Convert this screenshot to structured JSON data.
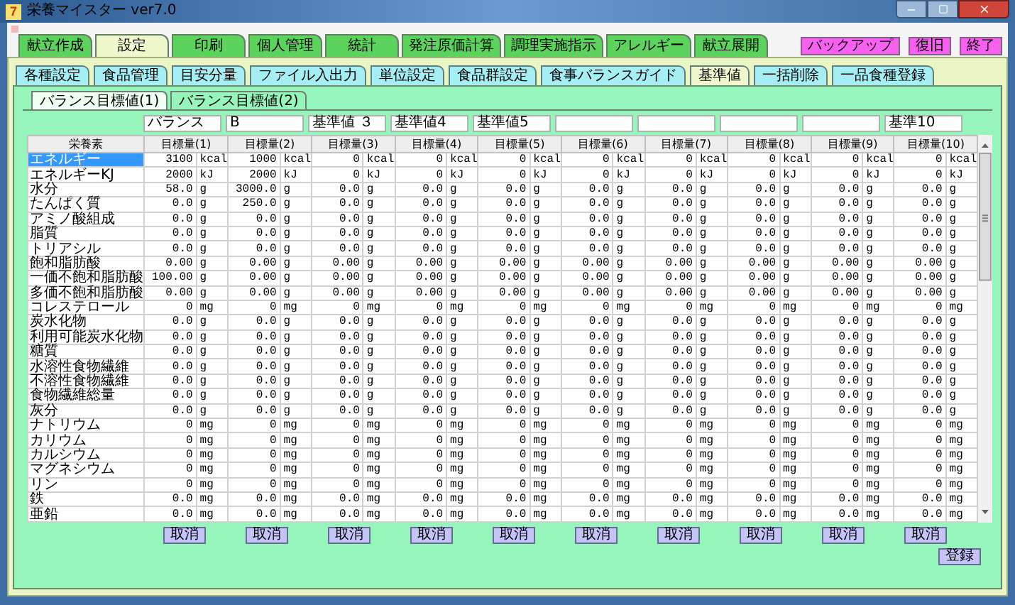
{
  "window": {
    "icon_text": "7",
    "title": "栄養マイスター ver7.0"
  },
  "main_tabs": [
    {
      "label": "献立作成",
      "selected": false
    },
    {
      "label": "設定",
      "selected": true
    },
    {
      "label": "印刷",
      "selected": false
    },
    {
      "label": "個人管理",
      "selected": false
    },
    {
      "label": "統計",
      "selected": false
    },
    {
      "label": "発注原価計算",
      "selected": false
    },
    {
      "label": "調理実施指示",
      "selected": false
    },
    {
      "label": "アレルギー",
      "selected": false
    },
    {
      "label": "献立展開",
      "selected": false
    }
  ],
  "top_buttons": [
    "バックアップ",
    "復旧",
    "終了"
  ],
  "sub_tabs": [
    {
      "label": "各種設定",
      "selected": false
    },
    {
      "label": "食品管理",
      "selected": false
    },
    {
      "label": "目安分量",
      "selected": false
    },
    {
      "label": "ファイル入出力",
      "selected": false
    },
    {
      "label": "単位設定",
      "selected": false
    },
    {
      "label": "食品群設定",
      "selected": false
    },
    {
      "label": "食事バランスガイド",
      "selected": false
    },
    {
      "label": "基準値",
      "selected": true
    },
    {
      "label": "一括削除",
      "selected": false
    },
    {
      "label": "一品食種登録",
      "selected": false
    }
  ],
  "inner_tabs": [
    {
      "label": "バランス目標値(1)",
      "selected": true
    },
    {
      "label": "バランス目標値(2)",
      "selected": false
    }
  ],
  "name_fields": [
    {
      "kind": "text",
      "value": "バランス"
    },
    {
      "kind": "text",
      "value": "B"
    },
    {
      "kind": "text",
      "value": "基準値 ３"
    },
    {
      "kind": "text",
      "value": "基準値4"
    },
    {
      "kind": "text",
      "value": "基準値5"
    },
    {
      "kind": "blank"
    },
    {
      "kind": "blank"
    },
    {
      "kind": "blank"
    },
    {
      "kind": "blank"
    },
    {
      "kind": "text",
      "value": "基準10"
    }
  ],
  "table": {
    "columns": [
      "栄養素",
      "目標量(1)",
      "目標量(2)",
      "目標量(3)",
      "目標量(4)",
      "目標量(5)",
      "目標量(6)",
      "目標量(7)",
      "目標量(8)",
      "目標量(9)",
      "目標量(10)"
    ],
    "rows": [
      {
        "name": "エネルギー",
        "selected": true,
        "values": [
          "3100",
          "1000",
          "0",
          "0",
          "0",
          "0",
          "0",
          "0",
          "0",
          "0"
        ],
        "units": [
          "kcal",
          "kcal",
          "kcal",
          "kcal",
          "kcal",
          "kcal",
          "kcal",
          "kcal",
          "kcal",
          "kcal"
        ]
      },
      {
        "name": "エネルギーKJ",
        "selected": false,
        "values": [
          "2000",
          "2000",
          "0",
          "0",
          "0",
          "0",
          "0",
          "0",
          "0",
          "0"
        ],
        "units": [
          "kJ",
          "kJ",
          "kJ",
          "kJ",
          "kJ",
          "kJ",
          "kJ",
          "kJ",
          "kJ",
          "kJ"
        ]
      },
      {
        "name": "水分",
        "selected": false,
        "values": [
          "58.0",
          "3000.0",
          "0.0",
          "0.0",
          "0.0",
          "0.0",
          "0.0",
          "0.0",
          "0.0",
          "0.0"
        ],
        "units": [
          "g",
          "g",
          "g",
          "g",
          "g",
          "g",
          "g",
          "g",
          "g",
          "g"
        ]
      },
      {
        "name": "たんぱく質",
        "selected": false,
        "values": [
          "0.0",
          "250.0",
          "0.0",
          "0.0",
          "0.0",
          "0.0",
          "0.0",
          "0.0",
          "0.0",
          "0.0"
        ],
        "units": [
          "g",
          "g",
          "g",
          "g",
          "g",
          "g",
          "g",
          "g",
          "g",
          "g"
        ]
      },
      {
        "name": "アミノ酸組成",
        "selected": false,
        "values": [
          "0.0",
          "0.0",
          "0.0",
          "0.0",
          "0.0",
          "0.0",
          "0.0",
          "0.0",
          "0.0",
          "0.0"
        ],
        "units": [
          "g",
          "g",
          "g",
          "g",
          "g",
          "g",
          "g",
          "g",
          "g",
          "g"
        ]
      },
      {
        "name": "脂質",
        "selected": false,
        "values": [
          "0.0",
          "0.0",
          "0.0",
          "0.0",
          "0.0",
          "0.0",
          "0.0",
          "0.0",
          "0.0",
          "0.0"
        ],
        "units": [
          "g",
          "g",
          "g",
          "g",
          "g",
          "g",
          "g",
          "g",
          "g",
          "g"
        ]
      },
      {
        "name": "トリアシル",
        "selected": false,
        "values": [
          "0.0",
          "0.0",
          "0.0",
          "0.0",
          "0.0",
          "0.0",
          "0.0",
          "0.0",
          "0.0",
          "0.0"
        ],
        "units": [
          "g",
          "g",
          "g",
          "g",
          "g",
          "g",
          "g",
          "g",
          "g",
          "g"
        ]
      },
      {
        "name": "飽和脂肪酸",
        "selected": false,
        "values": [
          "0.00",
          "0.00",
          "0.00",
          "0.00",
          "0.00",
          "0.00",
          "0.00",
          "0.00",
          "0.00",
          "0.00"
        ],
        "units": [
          "g",
          "g",
          "g",
          "g",
          "g",
          "g",
          "g",
          "g",
          "g",
          "g"
        ]
      },
      {
        "name": "一価不飽和脂肪酸",
        "selected": false,
        "values": [
          "100.00",
          "0.00",
          "0.00",
          "0.00",
          "0.00",
          "0.00",
          "0.00",
          "0.00",
          "0.00",
          "0.00"
        ],
        "units": [
          "g",
          "g",
          "g",
          "g",
          "g",
          "g",
          "g",
          "g",
          "g",
          "g"
        ]
      },
      {
        "name": "多価不飽和脂肪酸",
        "selected": false,
        "values": [
          "0.00",
          "0.00",
          "0.00",
          "0.00",
          "0.00",
          "0.00",
          "0.00",
          "0.00",
          "0.00",
          "0.00"
        ],
        "units": [
          "g",
          "g",
          "g",
          "g",
          "g",
          "g",
          "g",
          "g",
          "g",
          "g"
        ]
      },
      {
        "name": "コレステロール",
        "selected": false,
        "values": [
          "0",
          "0",
          "0",
          "0",
          "0",
          "0",
          "0",
          "0",
          "0",
          "0"
        ],
        "units": [
          "mg",
          "mg",
          "mg",
          "mg",
          "mg",
          "mg",
          "mg",
          "mg",
          "mg",
          "mg"
        ]
      },
      {
        "name": "炭水化物",
        "selected": false,
        "values": [
          "0.0",
          "0.0",
          "0.0",
          "0.0",
          "0.0",
          "0.0",
          "0.0",
          "0.0",
          "0.0",
          "0.0"
        ],
        "units": [
          "g",
          "g",
          "g",
          "g",
          "g",
          "g",
          "g",
          "g",
          "g",
          "g"
        ]
      },
      {
        "name": "利用可能炭水化物",
        "selected": false,
        "values": [
          "0.0",
          "0.0",
          "0.0",
          "0.0",
          "0.0",
          "0.0",
          "0.0",
          "0.0",
          "0.0",
          "0.0"
        ],
        "units": [
          "g",
          "g",
          "g",
          "g",
          "g",
          "g",
          "g",
          "g",
          "g",
          "g"
        ]
      },
      {
        "name": "糖質",
        "selected": false,
        "values": [
          "0.0",
          "0.0",
          "0.0",
          "0.0",
          "0.0",
          "0.0",
          "0.0",
          "0.0",
          "0.0",
          "0.0"
        ],
        "units": [
          "g",
          "g",
          "g",
          "g",
          "g",
          "g",
          "g",
          "g",
          "g",
          "g"
        ]
      },
      {
        "name": "水溶性食物繊維",
        "selected": false,
        "values": [
          "0.0",
          "0.0",
          "0.0",
          "0.0",
          "0.0",
          "0.0",
          "0.0",
          "0.0",
          "0.0",
          "0.0"
        ],
        "units": [
          "g",
          "g",
          "g",
          "g",
          "g",
          "g",
          "g",
          "g",
          "g",
          "g"
        ]
      },
      {
        "name": "不溶性食物繊維",
        "selected": false,
        "values": [
          "0.0",
          "0.0",
          "0.0",
          "0.0",
          "0.0",
          "0.0",
          "0.0",
          "0.0",
          "0.0",
          "0.0"
        ],
        "units": [
          "g",
          "g",
          "g",
          "g",
          "g",
          "g",
          "g",
          "g",
          "g",
          "g"
        ]
      },
      {
        "name": "食物繊維総量",
        "selected": false,
        "values": [
          "0.0",
          "0.0",
          "0.0",
          "0.0",
          "0.0",
          "0.0",
          "0.0",
          "0.0",
          "0.0",
          "0.0"
        ],
        "units": [
          "g",
          "g",
          "g",
          "g",
          "g",
          "g",
          "g",
          "g",
          "g",
          "g"
        ]
      },
      {
        "name": "灰分",
        "selected": false,
        "values": [
          "0.0",
          "0.0",
          "0.0",
          "0.0",
          "0.0",
          "0.0",
          "0.0",
          "0.0",
          "0.0",
          "0.0"
        ],
        "units": [
          "g",
          "g",
          "g",
          "g",
          "g",
          "g",
          "g",
          "g",
          "g",
          "g"
        ]
      },
      {
        "name": "ナトリウム",
        "selected": false,
        "values": [
          "0",
          "0",
          "0",
          "0",
          "0",
          "0",
          "0",
          "0",
          "0",
          "0"
        ],
        "units": [
          "mg",
          "mg",
          "mg",
          "mg",
          "mg",
          "mg",
          "mg",
          "mg",
          "mg",
          "mg"
        ]
      },
      {
        "name": "カリウム",
        "selected": false,
        "values": [
          "0",
          "0",
          "0",
          "0",
          "0",
          "0",
          "0",
          "0",
          "0",
          "0"
        ],
        "units": [
          "mg",
          "mg",
          "mg",
          "mg",
          "mg",
          "mg",
          "mg",
          "mg",
          "mg",
          "mg"
        ]
      },
      {
        "name": "カルシウム",
        "selected": false,
        "values": [
          "0",
          "0",
          "0",
          "0",
          "0",
          "0",
          "0",
          "0",
          "0",
          "0"
        ],
        "units": [
          "mg",
          "mg",
          "mg",
          "mg",
          "mg",
          "mg",
          "mg",
          "mg",
          "mg",
          "mg"
        ]
      },
      {
        "name": "マグネシウム",
        "selected": false,
        "values": [
          "0",
          "0",
          "0",
          "0",
          "0",
          "0",
          "0",
          "0",
          "0",
          "0"
        ],
        "units": [
          "mg",
          "mg",
          "mg",
          "mg",
          "mg",
          "mg",
          "mg",
          "mg",
          "mg",
          "mg"
        ]
      },
      {
        "name": "リン",
        "selected": false,
        "values": [
          "0",
          "0",
          "0",
          "0",
          "0",
          "0",
          "0",
          "0",
          "0",
          "0"
        ],
        "units": [
          "mg",
          "mg",
          "mg",
          "mg",
          "mg",
          "mg",
          "mg",
          "mg",
          "mg",
          "mg"
        ]
      },
      {
        "name": "鉄",
        "selected": false,
        "values": [
          "0.0",
          "0.0",
          "0.0",
          "0.0",
          "0.0",
          "0.0",
          "0.0",
          "0.0",
          "0.0",
          "0.0"
        ],
        "units": [
          "mg",
          "mg",
          "mg",
          "mg",
          "mg",
          "mg",
          "mg",
          "mg",
          "mg",
          "mg"
        ]
      },
      {
        "name": "亜鉛",
        "selected": false,
        "values": [
          "0.0",
          "0.0",
          "0.0",
          "0.0",
          "0.0",
          "0.0",
          "0.0",
          "0.0",
          "0.0",
          "0.0"
        ],
        "units": [
          "mg",
          "mg",
          "mg",
          "mg",
          "mg",
          "mg",
          "mg",
          "mg",
          "mg",
          "mg"
        ]
      }
    ]
  },
  "cancel_buttons": [
    "取消",
    "取消",
    "取消",
    "取消",
    "取消",
    "取消",
    "取消",
    "取消",
    "取消",
    "取消"
  ],
  "register_button": "登録"
}
